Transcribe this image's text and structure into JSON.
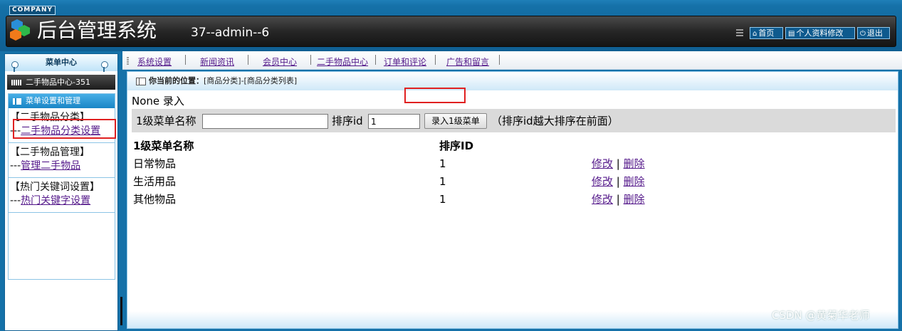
{
  "header": {
    "company": "COMPANY",
    "title": "后台管理系统",
    "user_info": "37--admin--6",
    "buttons": {
      "home": "首页",
      "profile": "个人资料修改",
      "logout": "退出"
    }
  },
  "sidebar": {
    "menu_center": "菜单中心",
    "section": "二手物品中心-351",
    "box_title": "菜单设置和管理",
    "groups": [
      {
        "title": "【二手物品分类】",
        "prefix": "---",
        "link": "二手物品分类设置"
      },
      {
        "title": "【二手物品管理】",
        "prefix": "---",
        "link": "管理二手物品"
      },
      {
        "title": "【热门关键词设置】",
        "prefix": "---",
        "link": "热门关键字设置"
      }
    ]
  },
  "nav": {
    "items": [
      "系统设置",
      "新闻资讯",
      "会员中心",
      "二手物品中心",
      "订单和评论",
      "广告和留言"
    ]
  },
  "main": {
    "breadcrumb_label": "你当前的位置：",
    "breadcrumb_path": "[商品分类]-[商品分类列表]",
    "none_text": "None 录入",
    "form": {
      "name_label": "1级菜单名称",
      "name_value": "",
      "sort_label": "排序id",
      "sort_value": "1",
      "submit_label": "录入1级菜单",
      "hint": "（排序id越大排序在前面）"
    },
    "table": {
      "headers": [
        "1级菜单名称",
        "排序ID"
      ],
      "rows": [
        {
          "name": "日常物品",
          "sort": "1",
          "edit": "修改",
          "sep": "|",
          "delete": "删除"
        },
        {
          "name": "生活用品",
          "sort": "1",
          "edit": "修改",
          "sep": "|",
          "delete": "删除"
        },
        {
          "name": "其他物品",
          "sort": "1",
          "edit": "修改",
          "sep": "|",
          "delete": "删除"
        }
      ]
    }
  },
  "watermark": "CSDN @黄菊华老师",
  "colors": {
    "frame_blue": "#1571a8",
    "header_dark": "#262626",
    "highlight_red": "#e02020",
    "link_purple": "#551a8b"
  }
}
